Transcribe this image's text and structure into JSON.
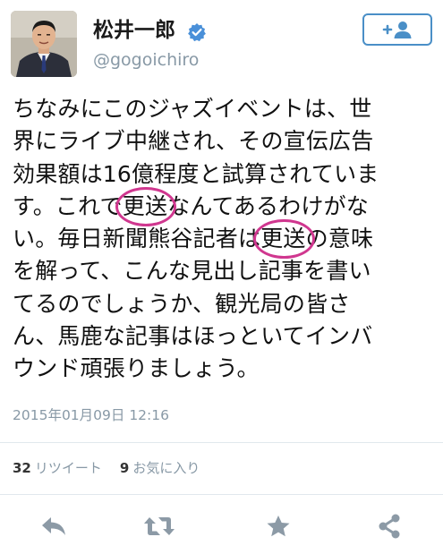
{
  "user": {
    "display_name": "松井一郎",
    "username": "@gogoichiro",
    "verified": true
  },
  "follow_button": {
    "icon": "add-user-icon",
    "label": "+"
  },
  "tweet": {
    "lines": [
      "ちなみにこのジャズイベントは、世",
      "界にライブ中継され、その宣伝広告",
      "効果額は16億程度と試算されていま",
      "す。これで",
      "なんてあるわけがな",
      "い。毎日新聞熊谷記者は",
      "の意味",
      "を解って、こんな見出し記事を書い",
      "てるのでしょうか、観光局の皆さ",
      "ん、馬鹿な記事はほっといてインバ",
      "ウンド頑張りましょう。"
    ],
    "highlight_word": "更送",
    "timestamp": "2015年01月09日 12:16"
  },
  "stats": {
    "retweets_count": "32",
    "retweets_label": "リツイート",
    "favorites_count": "9",
    "favorites_label": "お気に入り"
  },
  "actions": [
    "reply-icon",
    "retweet-icon",
    "favorite-icon",
    "share-icon"
  ],
  "colors": {
    "accent": "#4a8fc7",
    "muted": "#8899a6",
    "icon": "#8c9aa6",
    "highlight": "#d0378f",
    "verified": "#4a90d9"
  }
}
